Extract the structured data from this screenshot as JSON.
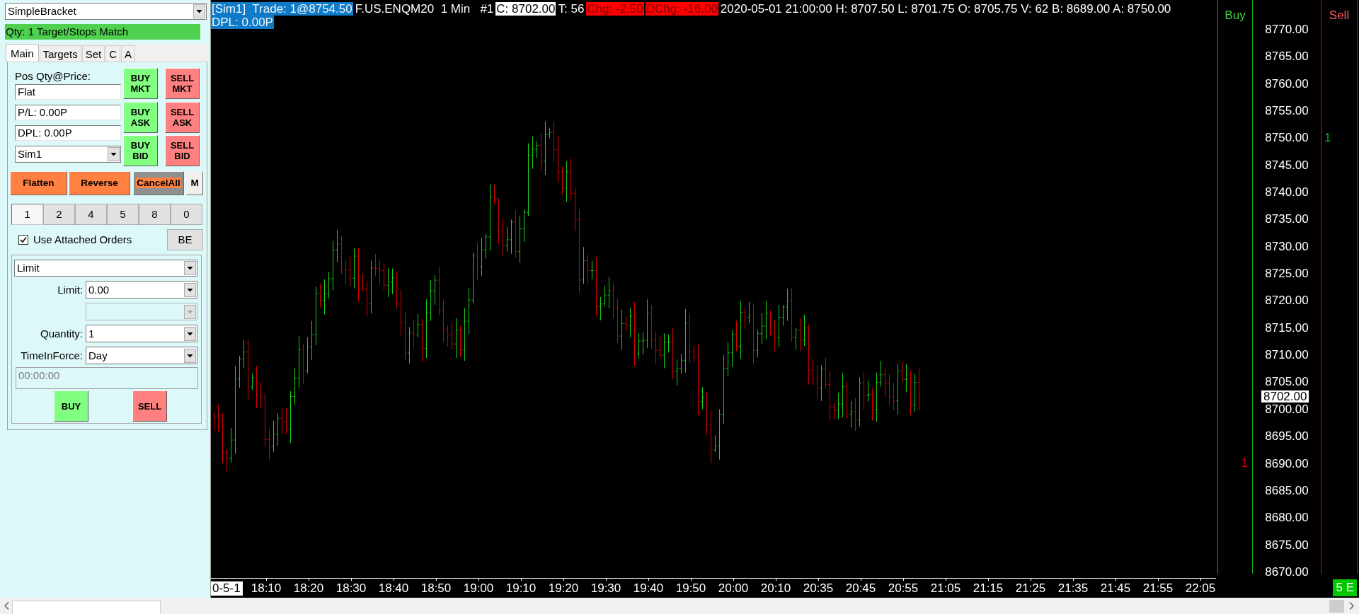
{
  "order_panel": {
    "strategy": "SimpleBracket",
    "status": "Qty: 1 Target/Stops Match",
    "tabs": [
      {
        "label": "Main",
        "selected": true
      },
      {
        "label": "Targets",
        "selected": false
      },
      {
        "label": "Set",
        "selected": false
      },
      {
        "label": "C",
        "selected": false
      },
      {
        "label": "A",
        "selected": false
      }
    ],
    "position_label": "Pos Qty@Price:",
    "readouts": [
      "Flat",
      "P/L: 0.00P",
      "DPL: 0.00P"
    ],
    "account": "Sim1",
    "quick_buttons": [
      {
        "label": "BUY MKT",
        "kind": "buy"
      },
      {
        "label": "SELL MKT",
        "kind": "sell"
      },
      {
        "label": "BUY ASK",
        "kind": "buy"
      },
      {
        "label": "SELL ASK",
        "kind": "sell"
      },
      {
        "label": "BUY BID",
        "kind": "buy"
      },
      {
        "label": "SELL BID",
        "kind": "sell"
      }
    ],
    "action_buttons": [
      {
        "label": "Flatten",
        "kind": "action"
      },
      {
        "label": "Reverse",
        "kind": "action"
      },
      {
        "label": "CancelAll",
        "kind": "cancel"
      },
      {
        "label": "M",
        "kind": "plain"
      }
    ],
    "quantity_presets": [
      {
        "label": "1",
        "selected": true
      },
      {
        "label": "2",
        "selected": false
      },
      {
        "label": "4",
        "selected": false
      },
      {
        "label": "5",
        "selected": false
      },
      {
        "label": "8",
        "selected": false
      },
      {
        "label": "0",
        "selected": false
      }
    ],
    "attached_orders": {
      "label": "Use Attached Orders",
      "checked": true
    },
    "be_button": "BE",
    "order_form": {
      "order_type": "Limit",
      "fields": [
        {
          "label": "Limit:",
          "value": "0.00",
          "disabled": false
        },
        {
          "disabled": true
        },
        {
          "label": "Quantity:",
          "value": "1",
          "disabled": false
        },
        {
          "label": "TimeInForce:",
          "value": "Day",
          "disabled": false
        }
      ],
      "time": {
        "value": "00:00:00",
        "disabled": true
      },
      "buttons": [
        {
          "label": "BUY",
          "kind": "buy"
        },
        {
          "label": "SELL",
          "kind": "sell"
        }
      ]
    }
  },
  "chart": {
    "header_lines": [
      {
        "segments": [
          {
            "text": "[Sim1]  Trade: 1@8754.50",
            "kind": "highlight"
          },
          {
            "text": "F.US.ENQM20  1 Min   #1",
            "kind": "plain"
          },
          {
            "text": "C: 8702.00",
            "kind": "inverse"
          },
          {
            "text": "T: 56",
            "kind": "plain"
          },
          {
            "text": "Chg: -2.50",
            "kind": "alert"
          },
          {
            "text": "DChg: -16.00",
            "kind": "alert"
          },
          {
            "text": "2020-05-01 21:00:00 H: 8707.50 L: 8701.75 O: 8705.75 V: 62 B: 8689.00 A: 8750.00",
            "kind": "plain"
          }
        ]
      },
      {
        "segments": [
          {
            "text": "DPL: 0.00P",
            "kind": "highlight"
          }
        ]
      }
    ],
    "buy_column": {
      "title": "Buy",
      "order_count": "1"
    },
    "sell_column": {
      "title": "Sell",
      "order_count": "1"
    },
    "price_axis": {
      "labels": [
        "8770.00",
        "8765.00",
        "8760.00",
        "8755.00",
        "8750.00",
        "8745.00",
        "8740.00",
        "8735.00",
        "8730.00",
        "8725.00",
        "8720.00",
        "8715.00",
        "8710.00",
        "8705.00",
        "8700.00",
        "8695.00",
        "8690.00",
        "8685.00",
        "8680.00",
        "8675.00",
        "8670.00"
      ],
      "current_price": "8702.00"
    },
    "time_axis": {
      "start_label": "0-5-1",
      "labels": [
        "18:10",
        "18:20",
        "18:30",
        "18:40",
        "18:50",
        "19:00",
        "19:10",
        "19:20",
        "19:30",
        "19:40",
        "19:50",
        "20:00",
        "20:10",
        "20:35",
        "20:45",
        "20:55",
        "21:05",
        "21:15",
        "21:25",
        "21:35",
        "21:45",
        "21:55",
        "22:05"
      ]
    },
    "status_badge": "5 E"
  }
}
